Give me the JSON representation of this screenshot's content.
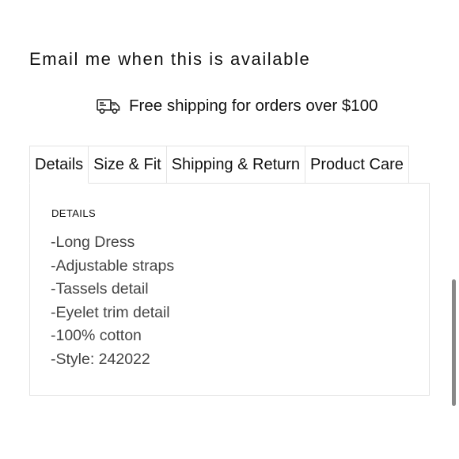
{
  "notify": {
    "label": "Email me when this is available"
  },
  "shipping": {
    "icon": "truck-icon",
    "text": "Free shipping for orders over $100"
  },
  "tabs": [
    {
      "label": "Details",
      "active": true
    },
    {
      "label": "Size & Fit",
      "active": false
    },
    {
      "label": "Shipping & Return",
      "active": false
    },
    {
      "label": "Product Care",
      "active": false
    }
  ],
  "details": {
    "heading": "DETAILS",
    "items": [
      "-Long Dress",
      "-Adjustable straps",
      "-Tassels detail",
      "-Eyelet trim detail",
      "-100% cotton",
      "-Style: 242022"
    ]
  }
}
